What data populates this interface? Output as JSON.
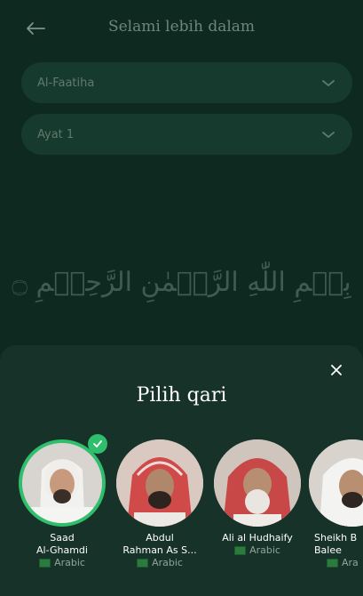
{
  "header": {
    "title": "Selami lebih dalam"
  },
  "surah_select": {
    "value": "Al-Faatiha"
  },
  "ayat_select": {
    "value": "Ayat 1"
  },
  "verse": {
    "text": "بِسۡمِ اللّٰهِ الرَّحۡمٰنِ الرَّحِيۡمِ ۝"
  },
  "sheet": {
    "title": "Pilih qari",
    "reciters": [
      {
        "name": "Saad\nAl-Ghamdi",
        "language": "Arabic",
        "selected": true
      },
      {
        "name": "Abdul\nRahman As S...",
        "language": "Arabic",
        "selected": false
      },
      {
        "name": "Ali al Hudhaify",
        "language": "Arabic",
        "selected": false
      },
      {
        "name": "Sheikh B\nBalee",
        "language": "Ara",
        "selected": false
      }
    ]
  },
  "colors": {
    "accent": "#2fbe6c",
    "background": "#0e2a20",
    "sheet": "#173329"
  }
}
